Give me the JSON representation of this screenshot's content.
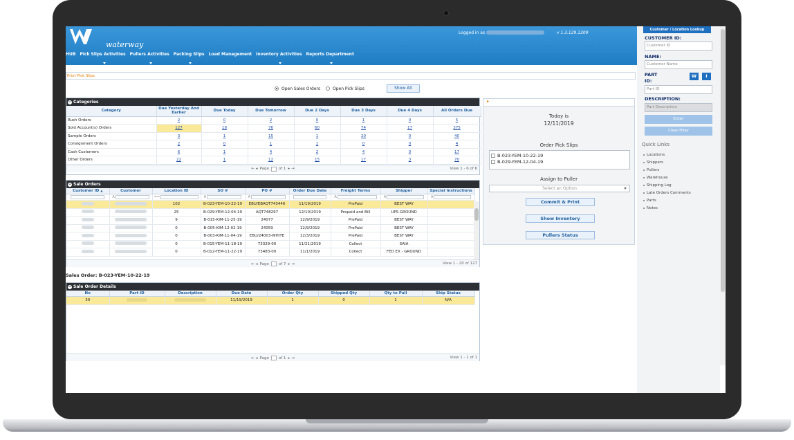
{
  "header": {
    "logo_text": "waterway",
    "logged_in_label": "Logged in as",
    "version": "v 1.3.129.1209"
  },
  "nav": [
    {
      "label": "HUB",
      "chevron": false
    },
    {
      "label": "Pick Slips Activities",
      "chevron": true
    },
    {
      "label": "Pullers Activities",
      "chevron": true
    },
    {
      "label": "Packing Slips",
      "chevron": true
    },
    {
      "label": "Load Management",
      "chevron": false
    },
    {
      "label": "Inventory Activities",
      "chevron": true
    },
    {
      "label": "Reports Department",
      "chevron": true
    }
  ],
  "breadcrumb": "Print Pick Slips",
  "filters": {
    "open_sales": "Open Sales Orders",
    "open_pick": "Open Pick Slips",
    "show_all": "Show All"
  },
  "categories": {
    "title": "Categories",
    "columns": [
      "Category",
      "Due Yesterday And Earlier",
      "Due Today",
      "Due Tomorrow",
      "Due 2 Days",
      "Due 3 Days",
      "Due 4 Days",
      "All Orders Due"
    ],
    "rows": [
      {
        "name": "Rush Orders",
        "values": [
          "2",
          "0",
          "2",
          "0",
          "1",
          "0",
          "5"
        ]
      },
      {
        "name": "Sold Account(s) Orders",
        "values": [
          "127",
          "18",
          "76",
          "60",
          "74",
          "17",
          "375"
        ]
      },
      {
        "name": "Sample Orders",
        "values": [
          "3",
          "1",
          "15",
          "1",
          "20",
          "0",
          "40"
        ]
      },
      {
        "name": "Consignment Orders",
        "values": [
          "2",
          "0",
          "1",
          "1",
          "0",
          "0",
          "4"
        ]
      },
      {
        "name": "Cash Customers",
        "values": [
          "6",
          "1",
          "4",
          "2",
          "4",
          "0",
          "17"
        ]
      },
      {
        "name": "Other Orders",
        "values": [
          "22",
          "1",
          "12",
          "15",
          "17",
          "3",
          "70"
        ]
      }
    ],
    "pager": {
      "page": "Page",
      "of": "of 1",
      "view": "View 1 - 6 of 6"
    }
  },
  "sale_orders": {
    "title": "Sale Orders",
    "columns": [
      "Customer ID",
      "Customer",
      "Location ID",
      "SO #",
      "PO #",
      "Order Due Date",
      "Freight Terms",
      "Shipper",
      "Special Instructions"
    ],
    "sort_marker": "▲",
    "rows": [
      {
        "loc": "102",
        "so": "B-023-YEM-10-22-19",
        "po": "EBU/EBAQT743446",
        "due": "11/19/2019",
        "freight": "PrePaid",
        "shipper": "BEST WAY"
      },
      {
        "loc": "25",
        "so": "B-029-YEM-12-04-19",
        "po": "AQT748297",
        "due": "12/10/2019",
        "freight": "Prepaid and Bill",
        "shipper": "UPS GROUND"
      },
      {
        "loc": "9",
        "so": "B-015-KIM-11-25-19",
        "po": "24077",
        "due": "12/9/2019",
        "freight": "PrePaid",
        "shipper": "BEST WAY"
      },
      {
        "loc": "0",
        "so": "B-005-KIM-12-02-19",
        "po": "24059",
        "due": "12/9/2019",
        "freight": "PrePaid",
        "shipper": "BEST WAY"
      },
      {
        "loc": "0",
        "so": "B-003-KIM-11-04-19",
        "po": "EBU/24003-WHITE",
        "due": "12/3/2019",
        "freight": "PrePaid",
        "shipper": "BEST WAY"
      },
      {
        "loc": "0",
        "so": "B-015-YEM-11-18-19",
        "po": "73329-00",
        "due": "11/21/2019",
        "freight": "Collect",
        "shipper": "SAIA"
      },
      {
        "loc": "0",
        "so": "B-012-YEM-11-22-19",
        "po": "73483-00",
        "due": "11/1/2019",
        "freight": "Collect",
        "shipper": "FED EX - GROUND"
      }
    ],
    "pager": {
      "page": "Page",
      "of": "of 7",
      "view": "View 1 - 20 of 127"
    }
  },
  "sale_order_label": "Sales Order: B-023-YEM-10-22-19",
  "details": {
    "title": "Sale Order Details",
    "columns": [
      "No",
      "Part ID",
      "Description",
      "Due Date",
      "Order Qty",
      "Shipped Qty",
      "Qty to Pull",
      "Ship Status"
    ],
    "row": {
      "no": "39",
      "due": "11/19/2019",
      "order_qty": "1",
      "shipped": "0",
      "to_pull": "1",
      "status": "N/A"
    },
    "pager": {
      "page": "Page",
      "of": "of 1",
      "view": "View 1 - 1 of 1"
    }
  },
  "right_panel": {
    "today_label": "Today is",
    "today_date": "12/11/2019",
    "order_pick_slips": "Order Pick Slips",
    "pick_slips": [
      "B-023-YEM-10-22-19",
      "B-029-YEM-12-04-19"
    ],
    "assign_label": "Assign to Puller",
    "select_placeholder": "Select an Option",
    "commit_print": "Commit & Print",
    "show_inventory": "Show Inventory",
    "pullers_status": "Pullers Status"
  },
  "sidebar": {
    "lookup_button": "Customer / Location Lookup",
    "customer_id_label": "CUSTOMER ID:",
    "customer_id_placeholder": "Customer ID",
    "name_label": "NAME:",
    "name_placeholder": "Customer Name",
    "part_label_1": "PART",
    "part_label_2": "ID:",
    "part_placeholder": "Part ID",
    "w_button": "W",
    "i_button": "I",
    "description_label": "DESCRIPTION:",
    "description_placeholder": "Part Description",
    "enter_button": "Enter",
    "clear_button": "Clear Filter",
    "quick_links_title": "Quick Links",
    "quick_links": [
      "Locations",
      "Shippers",
      "Pullers",
      "Warehouse",
      "Shipping Log",
      "Late Orders Comments",
      "Parts",
      "Notes"
    ]
  },
  "colors": {
    "header_blue": "#2a8bd2",
    "selected_row": "#fbe99a",
    "panel_header": "#2c2f33",
    "link": "#1f4fa8",
    "accent_orange": "#e07b00"
  }
}
